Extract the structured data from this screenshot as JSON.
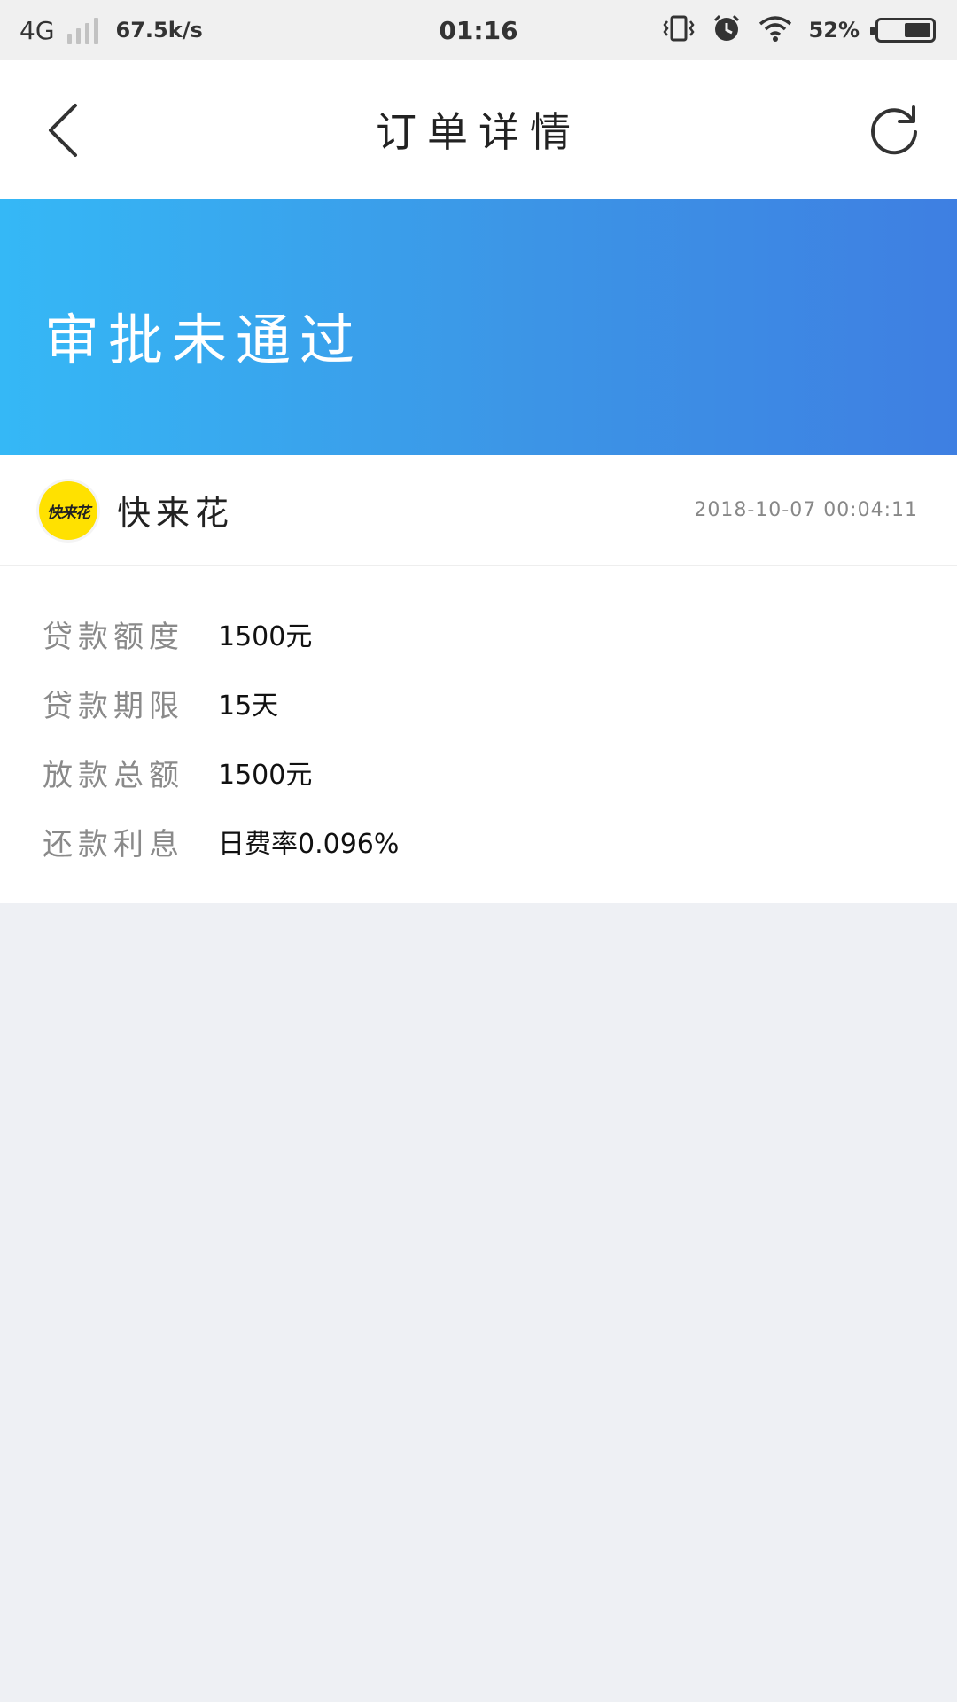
{
  "status_bar": {
    "network": "4G",
    "speed": "67.5k/s",
    "time": "01:16",
    "battery": "52%",
    "battery_level": 0.52
  },
  "nav": {
    "title": "订单详情",
    "back_icon": "chevron-left-icon",
    "refresh_icon": "refresh-icon"
  },
  "banner": {
    "status": "审批未通过",
    "colors": [
      "#35b8f6",
      "#3e7fe2"
    ]
  },
  "lender": {
    "logo_text": "快来花",
    "logo_color": "#ffe100",
    "name": "快来花",
    "date": "2018-10-07 00:04:11"
  },
  "details": [
    {
      "label": "贷款额度",
      "value": "1500元"
    },
    {
      "label": "贷款期限",
      "value": "15天"
    },
    {
      "label": "放款总额",
      "value": "1500元"
    },
    {
      "label": "还款利息",
      "value": "日费率0.096%"
    }
  ]
}
